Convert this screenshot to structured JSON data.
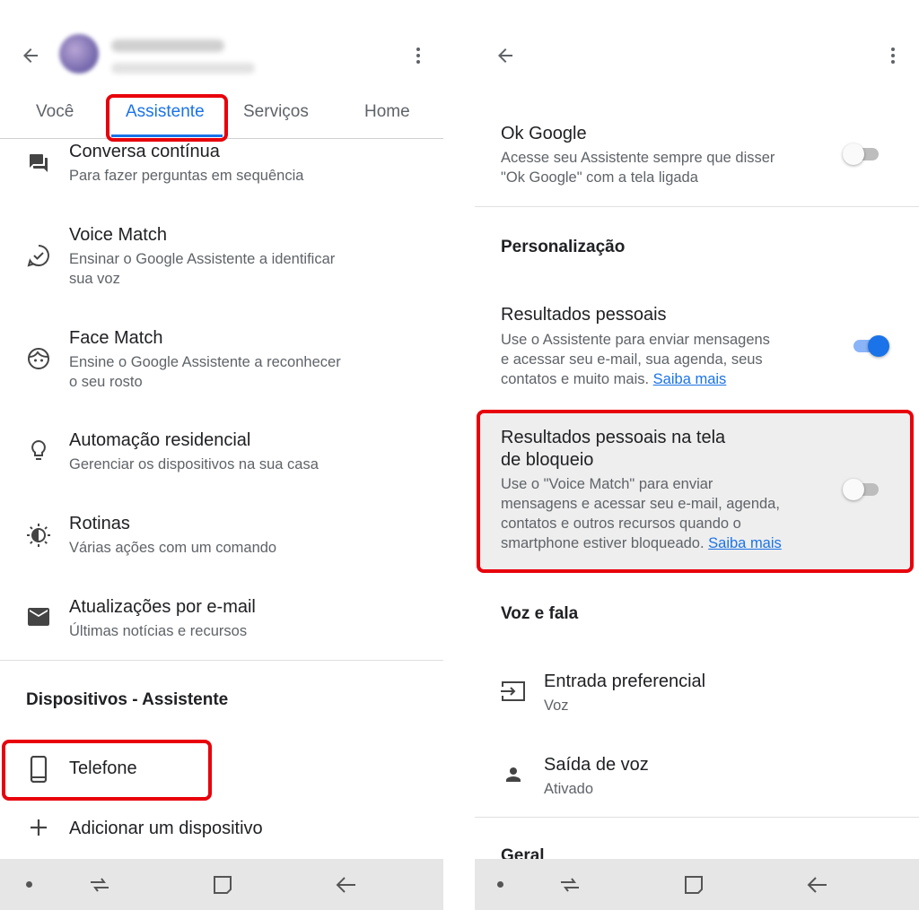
{
  "left": {
    "tabs": [
      {
        "label": "Você"
      },
      {
        "label": "Assistente"
      },
      {
        "label": "Serviços"
      },
      {
        "label": "Home"
      }
    ],
    "items": [
      {
        "title": "Conversa contínua",
        "subtitle": "Para fazer perguntas em sequência"
      },
      {
        "title": "Voice Match",
        "subtitle_line1": "Ensinar o Google Assistente a identificar",
        "subtitle_line2": "sua voz"
      },
      {
        "title": "Face Match",
        "subtitle_line1": "Ensine o Google Assistente a reconhecer",
        "subtitle_line2": "o seu rosto"
      },
      {
        "title": "Automação residencial",
        "subtitle": "Gerenciar os dispositivos na sua casa"
      },
      {
        "title": "Rotinas",
        "subtitle": "Várias ações com um comando"
      },
      {
        "title": "Atualizações por e-mail",
        "subtitle": "Últimas notícias e recursos"
      }
    ],
    "section_devices": "Dispositivos - Assistente",
    "phone_label": "Telefone",
    "add_device_label": "Adicionar um dispositivo"
  },
  "right": {
    "ok_google": {
      "title": "Ok Google",
      "line1": "Acesse seu Assistente sempre que disser",
      "line2": "\"Ok Google\" com a tela ligada",
      "enabled": false
    },
    "section_personalization": "Personalização",
    "personal_results": {
      "title": "Resultados pessoais",
      "line1": "Use o Assistente para enviar mensagens",
      "line2": "e acessar seu e-mail, sua agenda, seus",
      "line3": "contatos e muito mais.",
      "link": "Saiba mais",
      "enabled": true
    },
    "lock_screen_results": {
      "title_line1": "Resultados pessoais na tela",
      "title_line2": "de bloqueio",
      "line1": "Use o \"Voice Match\" para enviar",
      "line2": "mensagens e acessar seu e-mail, agenda,",
      "line3": "contatos e outros recursos quando o",
      "line4": "smartphone estiver bloqueado.",
      "link": "Saiba mais",
      "enabled": false
    },
    "section_voice": "Voz e fala",
    "preferred_input": {
      "title": "Entrada preferencial",
      "value": "Voz"
    },
    "voice_output": {
      "title": "Saída de voz",
      "value": "Ativado"
    },
    "section_general": "Geral"
  },
  "colors": {
    "accent": "#1a73e8",
    "highlight_border": "#e8000b",
    "highlight_bg": "#eeeeee",
    "navbar_bg": "#e6e6e6"
  },
  "icons": [
    "back-arrow-icon",
    "more-vert-icon",
    "chat-icon",
    "voice-match-icon",
    "face-icon",
    "lightbulb-icon",
    "routines-icon",
    "mail-icon",
    "phone-icon",
    "plus-icon",
    "input-icon",
    "person-icon",
    "recents-icon",
    "home-square-icon",
    "nav-back-icon"
  ]
}
